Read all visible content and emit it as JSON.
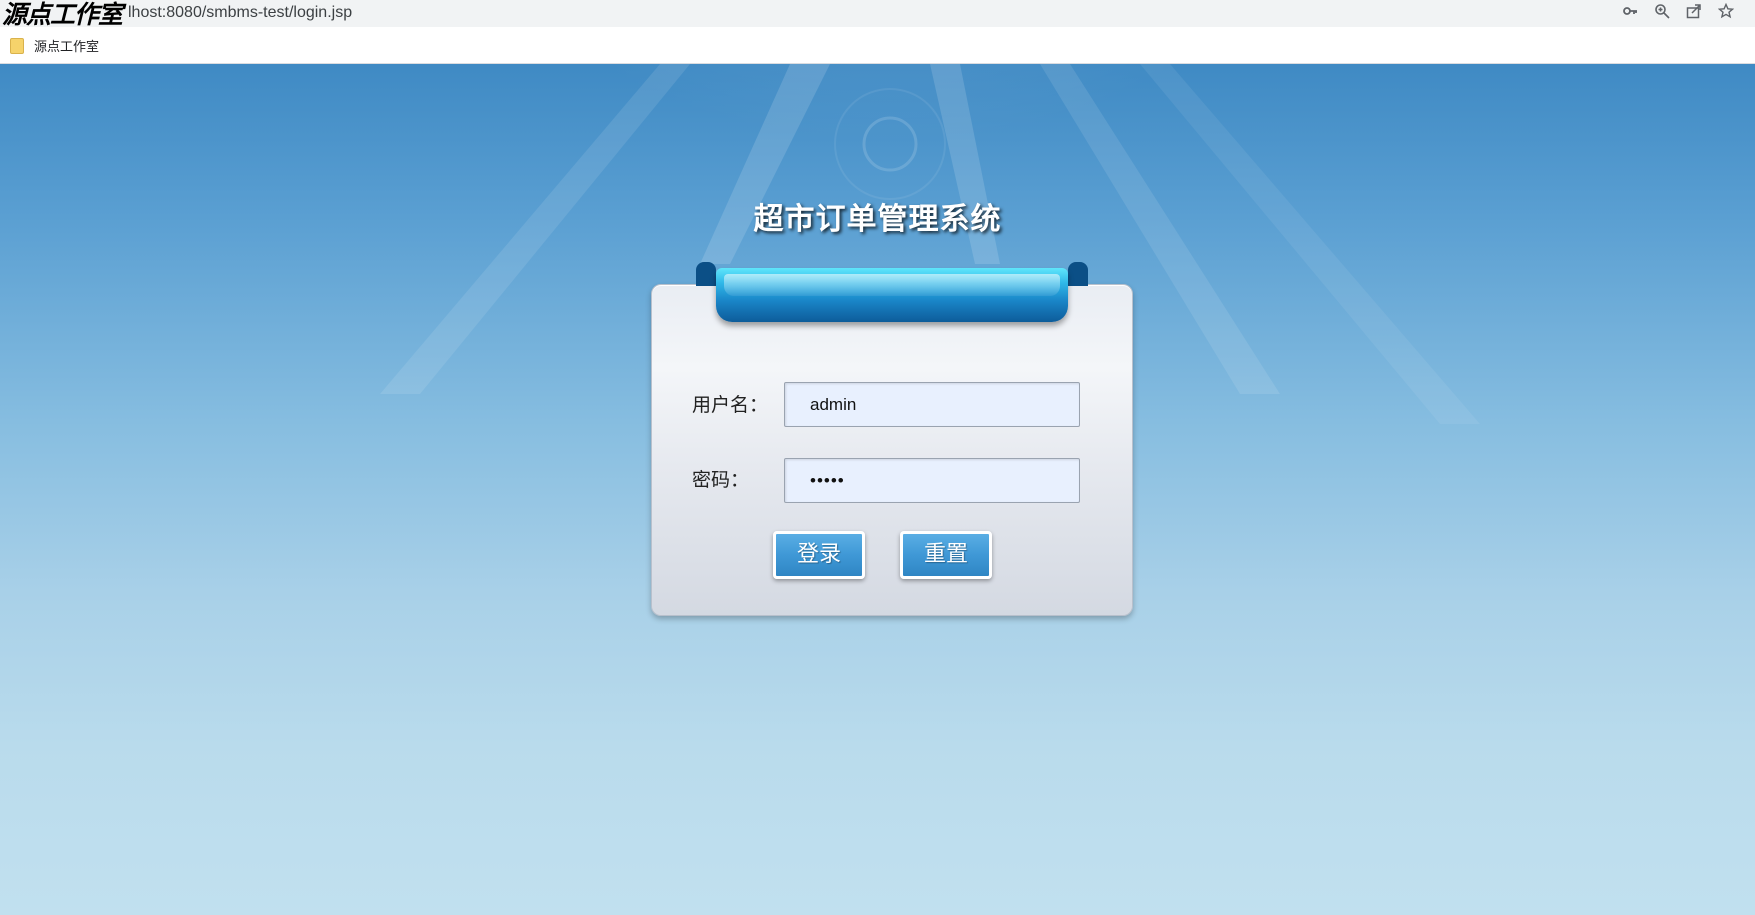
{
  "browser": {
    "url_visible": "lhost:8080/smbms-test/login.jsp",
    "watermark": "源点工作室",
    "icons": [
      "key-icon",
      "zoom-icon",
      "share-icon",
      "star-icon"
    ],
    "bookmark": {
      "label": "源点工作室",
      "icon": "folder-icon"
    }
  },
  "login": {
    "title": "超市订单管理系统",
    "username_label": "用户名：",
    "username_value": "admin",
    "password_label": "密码：",
    "password_value": "•••••",
    "login_button": "登录",
    "reset_button": "重置"
  },
  "colors": {
    "background_top": "#3f8ac4",
    "background_bottom": "#c1e0ef",
    "ribbon": "#1a86c8",
    "button": "#3f98d6",
    "input_bg": "#e8f0fe"
  }
}
